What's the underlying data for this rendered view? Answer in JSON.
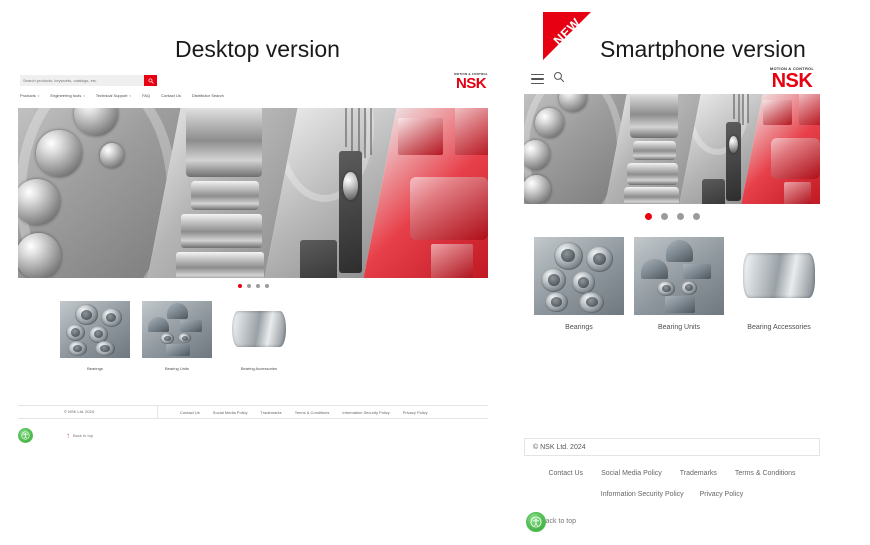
{
  "titles": {
    "desktop": "Desktop version",
    "smartphone": "Smartphone version"
  },
  "ribbon": {
    "label": "NEW",
    "color": "#e60012"
  },
  "brand": {
    "tagline": "MOTION & CONTROL",
    "name": "NSK",
    "color": "#e60012"
  },
  "desktop": {
    "search": {
      "placeholder": "Search products, keywords, catalogs, etc.",
      "value": "",
      "button_icon": "search-icon"
    },
    "nav": [
      {
        "label": "Products",
        "has_dropdown": true
      },
      {
        "label": "Engineering tools",
        "has_dropdown": true
      },
      {
        "label": "Technical Support",
        "has_dropdown": true
      },
      {
        "label": "FAQ",
        "has_dropdown": false
      },
      {
        "label": "Contact Us",
        "has_dropdown": false
      },
      {
        "label": "Distributor Search",
        "has_dropdown": false
      }
    ],
    "carousel": {
      "total": 4,
      "active_index": 0
    },
    "cards": [
      {
        "label": "Bearings"
      },
      {
        "label": "Bearing Units"
      },
      {
        "label": "Bearing Accessories"
      }
    ],
    "footer": {
      "copyright": "© NSK Ltd. 2024",
      "links": [
        "Contact Us",
        "Social Media Policy",
        "Trademarks",
        "Terms & Conditions",
        "Information Security Policy",
        "Privacy Policy"
      ],
      "back_to_top": "Back to top",
      "accessibility_icon": "accessibility-icon"
    }
  },
  "smartphone": {
    "menu_icon": "hamburger-menu-icon",
    "search_icon": "search-icon",
    "carousel": {
      "total": 4,
      "active_index": 0
    },
    "cards": [
      {
        "label": "Bearings"
      },
      {
        "label": "Bearing Units"
      },
      {
        "label": "Bearing Accessories"
      }
    ],
    "footer": {
      "copyright": "© NSK Ltd. 2024",
      "links_row1": [
        "Contact Us",
        "Social Media Policy",
        "Trademarks",
        "Terms & Conditions"
      ],
      "links_row2": [
        "Information Security Policy",
        "Privacy Policy"
      ],
      "back_to_top": "Back to top",
      "accessibility_icon": "accessibility-icon"
    }
  }
}
